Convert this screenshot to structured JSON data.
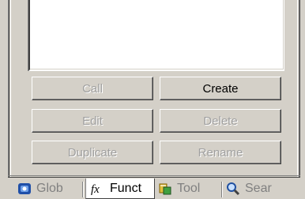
{
  "buttons": {
    "call": "Call",
    "create": "Create",
    "edit": "Edit",
    "delete": "Delete",
    "duplicate": "Duplicate",
    "rename": "Rename"
  },
  "tabs": [
    {
      "label": "Glob",
      "icon": "globals-icon",
      "active": false
    },
    {
      "label": "Funct",
      "icon": "function-fx-icon",
      "active": true
    },
    {
      "label": "Tool",
      "icon": "tools-icon",
      "active": false
    },
    {
      "label": "Sear",
      "icon": "search-icon",
      "active": false
    }
  ],
  "colors": {
    "face": "#d4d0c8",
    "disabled_text": "#a0a0a0",
    "list_background": "#ffffff"
  }
}
